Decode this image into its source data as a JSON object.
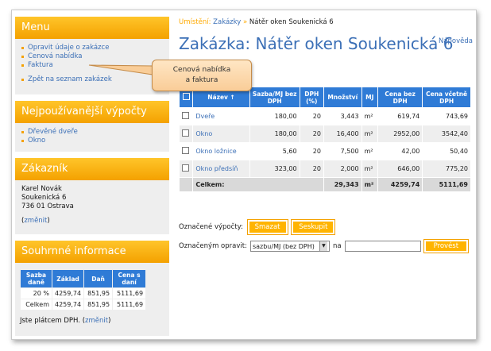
{
  "sidebar": {
    "menu": {
      "title": "Menu",
      "items": [
        "Opravit údaje o zakázce",
        "Cenová nabídka",
        "Faktura",
        "Zpět na seznam zakázek"
      ]
    },
    "frequent": {
      "title": "Nejpoužívanější výpočty",
      "items": [
        "Dřevěné dveře",
        "Okno"
      ]
    },
    "customer": {
      "title": "Zákazník",
      "name": "Karel Novák",
      "street": "Soukenická 6",
      "city": "736 01 Ostrava",
      "change": "změnit"
    },
    "summary": {
      "title": "Souhrnné informace",
      "headers": [
        "Sazba daně",
        "Základ",
        "Daň",
        "Cena s daní"
      ],
      "rows": [
        [
          "20 %",
          "4259,74",
          "851,95",
          "5111,69"
        ],
        [
          "Celkem",
          "4259,74",
          "851,95",
          "5111,69"
        ]
      ],
      "vat_note": "Jste plátcem DPH.",
      "change": "změnit"
    }
  },
  "breadcrumb": {
    "label": "Umístění:",
    "parent": "Zakázky",
    "separator": "»",
    "current": "Nátěr oken Soukenická 6"
  },
  "help": "Nápověda",
  "title": "Zakázka: Nátěr oken Soukenická 6",
  "table": {
    "headers": [
      "Název ↑",
      "Sazba/MJ bez DPH",
      "DPH (%)",
      "Množství",
      "MJ",
      "Cena bez DPH",
      "Cena včetně DPH"
    ],
    "rows": [
      {
        "name": "Dveře",
        "rate": "180,00",
        "vat": "20",
        "qty": "3,443",
        "unit": "m²",
        "net": "619,74",
        "gross": "743,69"
      },
      {
        "name": "Okno",
        "rate": "180,00",
        "vat": "20",
        "qty": "16,400",
        "unit": "m²",
        "net": "2952,00",
        "gross": "3542,40"
      },
      {
        "name": "Okno ložnice",
        "rate": "5,60",
        "vat": "20",
        "qty": "7,500",
        "unit": "m²",
        "net": "42,00",
        "gross": "50,40"
      },
      {
        "name": "Okno předsíň",
        "rate": "323,00",
        "vat": "20",
        "qty": "2,000",
        "unit": "m²",
        "net": "646,00",
        "gross": "775,20"
      }
    ],
    "total": {
      "label": "Celkem:",
      "qty": "29,343",
      "unit": "m²",
      "net": "4259,74",
      "gross": "5111,69"
    }
  },
  "actions": {
    "label": "Označené výpočty:",
    "delete": "Smazat",
    "group": "Seskupit"
  },
  "fix": {
    "label": "Označeným opravit:",
    "select_value": "sazbu/MJ (bez DPH)",
    "na": "na",
    "submit": "Provést"
  },
  "callout": {
    "line1": "Cenová nabídka",
    "line2": "a faktura"
  }
}
